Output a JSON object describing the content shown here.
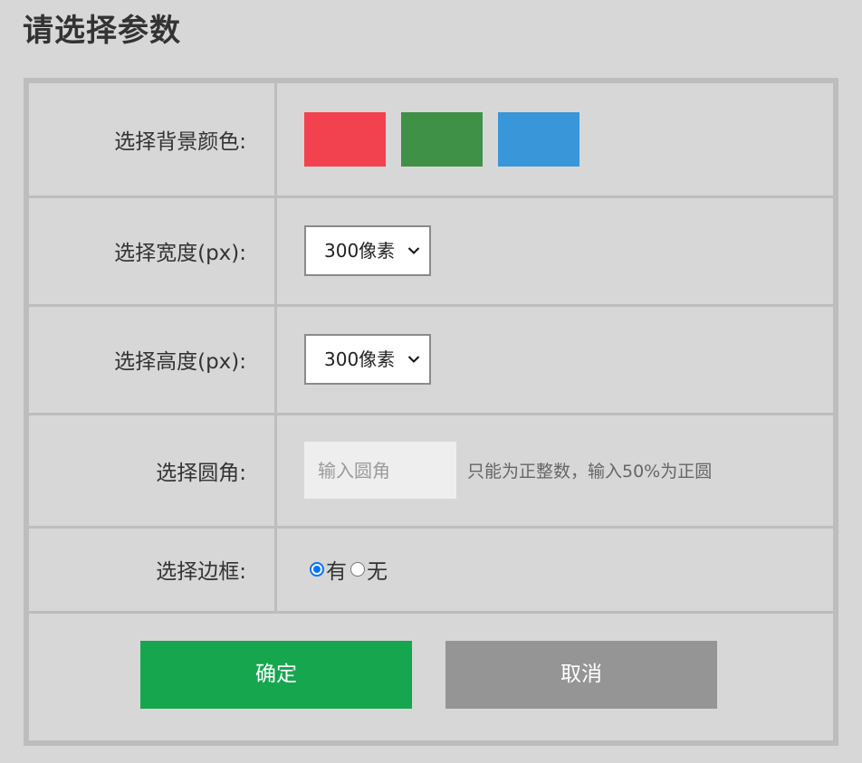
{
  "page": {
    "title": "请选择参数"
  },
  "form": {
    "background": {
      "label": "选择背景颜色:",
      "swatches": [
        {
          "name": "red",
          "color": "#f3424f"
        },
        {
          "name": "green",
          "color": "#3f9147"
        },
        {
          "name": "blue",
          "color": "#3996d8"
        }
      ]
    },
    "width": {
      "label": "选择宽度(px):",
      "selected": "300像素"
    },
    "height": {
      "label": "选择高度(px):",
      "selected": "300像素"
    },
    "radius": {
      "label": "选择圆角:",
      "value": "",
      "placeholder": "输入圆角",
      "hint": "只能为正整数，输入50%为正圆"
    },
    "border": {
      "label": "选择边框:",
      "options": [
        {
          "label": "有",
          "checked": true
        },
        {
          "label": "无",
          "checked": false
        }
      ]
    }
  },
  "actions": {
    "confirm_label": "确定",
    "cancel_label": "取消",
    "confirm_color": "#16a64e",
    "cancel_color": "#959595"
  }
}
